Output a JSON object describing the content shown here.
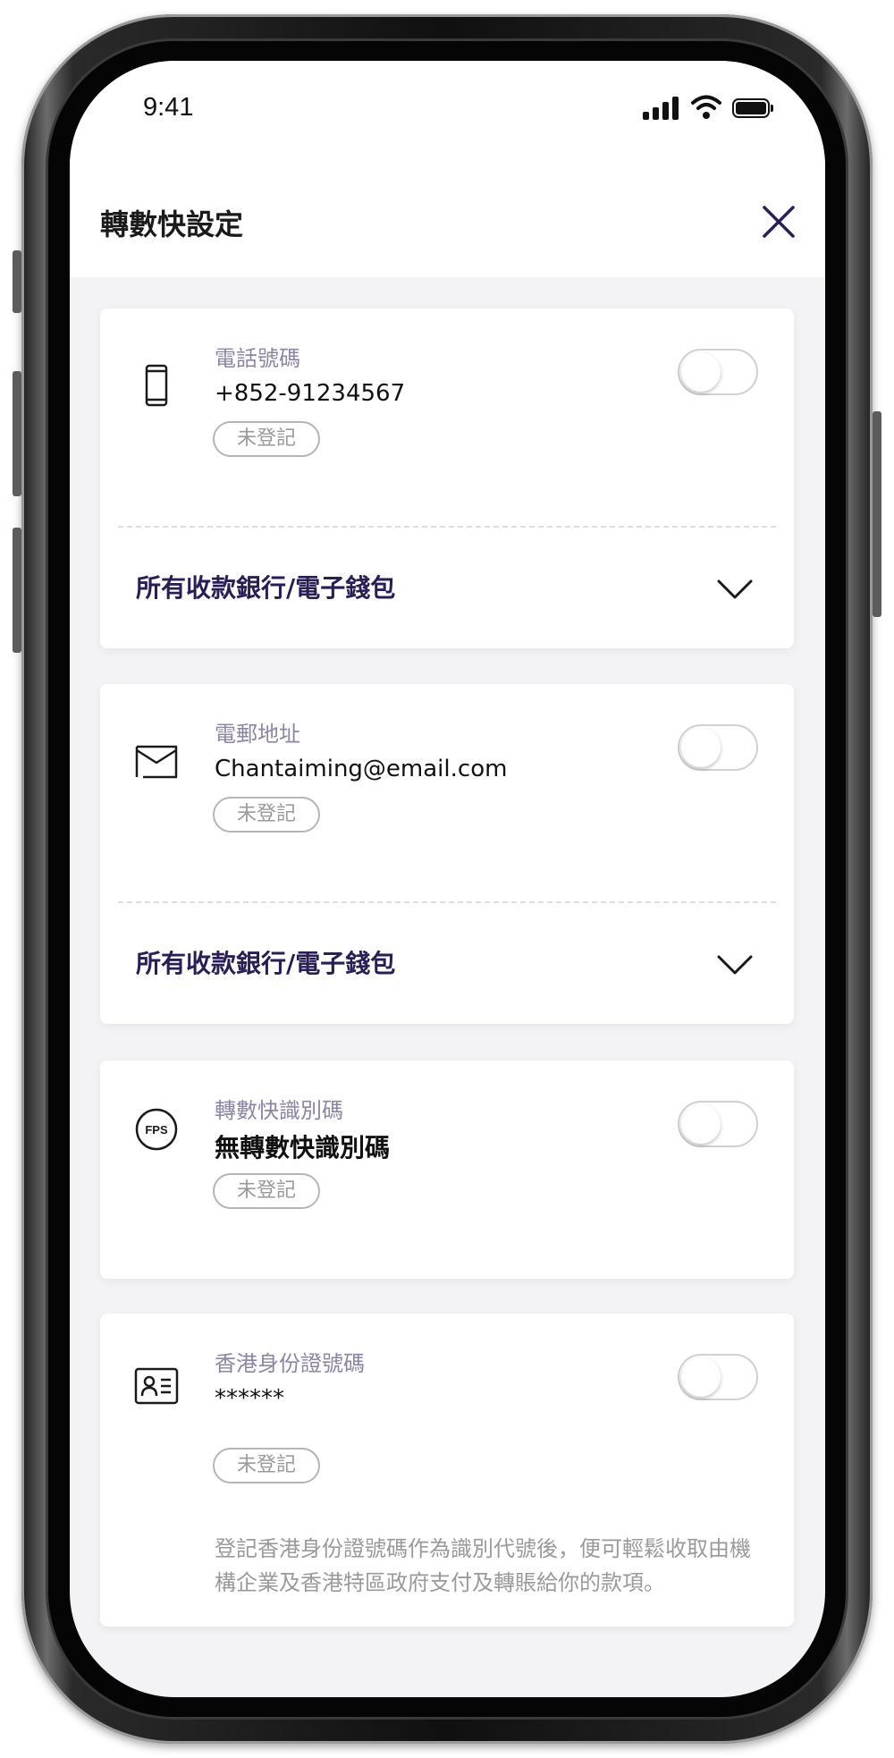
{
  "status_bar": {
    "time": "9:41"
  },
  "header": {
    "title": "轉數快設定"
  },
  "cards": [
    {
      "label": "電話號碼",
      "value": "+852-91234567",
      "status": "未登記",
      "bank_label": "所有收款銀行/電子錢包",
      "enabled": false
    },
    {
      "label": "電郵地址",
      "value": "Chantaiming@email.com",
      "status": "未登記",
      "bank_label": "所有收款銀行/電子錢包",
      "enabled": false
    },
    {
      "label": "轉數快識別碼",
      "value": "無轉數快識別碼",
      "status": "未登記",
      "enabled": false
    },
    {
      "label": "香港身份證號碼",
      "value": "******",
      "status": "未登記",
      "note": "登記香港身份證號碼作為識別代號後，便可輕鬆收取由機構企業及香港特區政府支付及轉賬給你的款項。",
      "enabled": false
    }
  ],
  "icons": {
    "card_0": "mobile-phone-icon",
    "card_1": "envelope-icon",
    "card_2": "fps-icon",
    "card_3": "id-card-icon"
  },
  "colors": {
    "label": "#8d84a6",
    "accent": "#2a1e55",
    "status": "#9a9a9a",
    "background": "#f3f3f6"
  }
}
